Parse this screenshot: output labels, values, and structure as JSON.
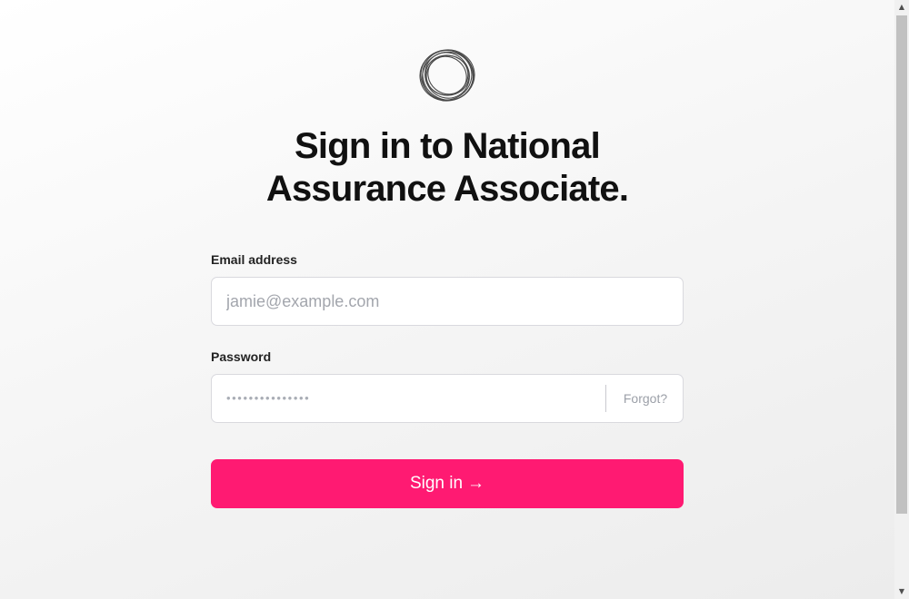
{
  "heading": {
    "line1": "Sign in to National",
    "line2": "Assurance Associate."
  },
  "logo": {
    "icon": "ring-logo-icon"
  },
  "email": {
    "label": "Email address",
    "placeholder": "jamie@example.com",
    "value": ""
  },
  "password": {
    "label": "Password",
    "masked_value": "•••••••••••••••",
    "forgot_label": "Forgot?"
  },
  "signin": {
    "label": "Sign in",
    "arrow": "→"
  },
  "colors": {
    "accent": "#ff1a72",
    "text": "#111111",
    "muted": "#a3a6ad",
    "border": "#d9d9de"
  },
  "scrollbar": {
    "up_icon": "triangle-up-icon",
    "down_icon": "triangle-down-icon"
  }
}
